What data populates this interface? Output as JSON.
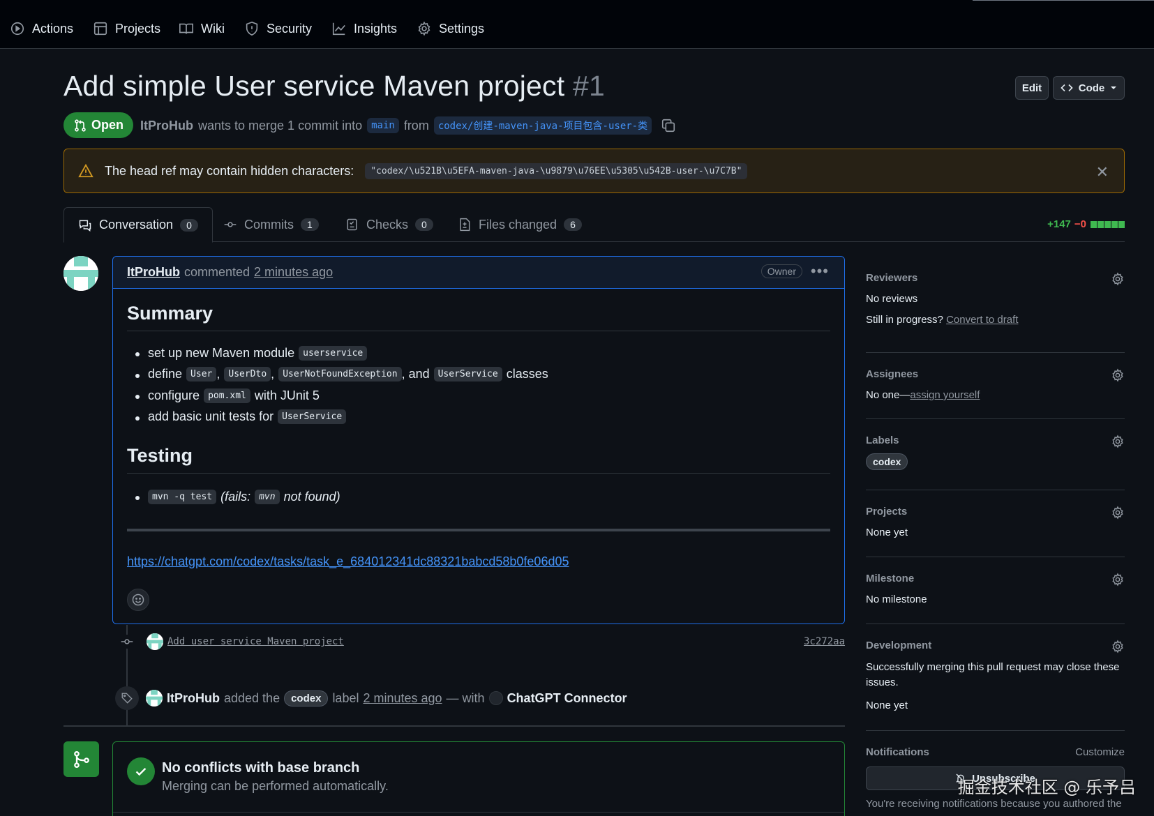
{
  "nav": {
    "items": [
      {
        "label": "Actions",
        "icon": "play-circle-icon"
      },
      {
        "label": "Projects",
        "icon": "table-icon"
      },
      {
        "label": "Wiki",
        "icon": "book-icon"
      },
      {
        "label": "Security",
        "icon": "shield-icon"
      },
      {
        "label": "Insights",
        "icon": "graph-icon"
      },
      {
        "label": "Settings",
        "icon": "gear-icon"
      }
    ]
  },
  "pr": {
    "title": "Add simple User service Maven project",
    "number": "#1",
    "edit_label": "Edit",
    "code_label": "Code",
    "state": "Open",
    "author": "ItProHub",
    "merge_text": "wants to merge 1 commit into",
    "base_branch": "main",
    "from_text": "from",
    "head_branch": "codex/创建-maven-java-项目包含-user-类"
  },
  "warning": {
    "text": "The head ref may contain hidden characters:",
    "ref": "\"codex/\\u521B\\u5EFA-maven-java-\\u9879\\u76EE\\u5305\\u542B-user-\\u7C7B\""
  },
  "tabs": [
    {
      "label": "Conversation",
      "count": "0"
    },
    {
      "label": "Commits",
      "count": "1"
    },
    {
      "label": "Checks",
      "count": "0"
    },
    {
      "label": "Files changed",
      "count": "6"
    }
  ],
  "diffstat": {
    "additions": "+147",
    "deletions": "−0"
  },
  "comment": {
    "author": "ItProHub",
    "action": "commented",
    "time": "2 minutes ago",
    "role": "Owner",
    "summary_heading": "Summary",
    "summary": {
      "item1_text": "set up new Maven module",
      "item1_code": "userservice",
      "item2_text": "define",
      "item2_code1": "User",
      "item2_code2": "UserDto",
      "item2_code3": "UserNotFoundException",
      "item2_and": ", and",
      "item2_code4": "UserService",
      "item2_tail": "classes",
      "item3_text": "configure",
      "item3_code": "pom.xml",
      "item3_tail": "with JUnit 5",
      "item4_text": "add basic unit tests for",
      "item4_code": "UserService"
    },
    "testing_heading": "Testing",
    "testing": {
      "code1": "mvn -q test",
      "fails": "(fails:",
      "code2": "mvn",
      "tail": "not found)"
    },
    "link": "https://chatgpt.com/codex/tasks/task_e_684012341dc88321babcd58b0fe06d05"
  },
  "timeline": {
    "commit_message": "Add user service Maven project",
    "commit_sha": "3c272aa",
    "label_author": "ItProHub",
    "label_added": "added the",
    "label_name": "codex",
    "label_word": "label",
    "label_time": "2 minutes ago",
    "label_with": "— with",
    "connector": "ChatGPT Connector"
  },
  "merge": {
    "title": "No conflicts with base branch",
    "subtitle": "Merging can be performed automatically."
  },
  "sidebar": {
    "reviewers": {
      "title": "Reviewers",
      "value": "No reviews",
      "progress_text": "Still in progress?",
      "progress_link": "Convert to draft"
    },
    "assignees": {
      "title": "Assignees",
      "value": "No one—",
      "link": "assign yourself"
    },
    "labels": {
      "title": "Labels",
      "value": "codex"
    },
    "projects": {
      "title": "Projects",
      "value": "None yet"
    },
    "milestone": {
      "title": "Milestone",
      "value": "No milestone"
    },
    "development": {
      "title": "Development",
      "text": "Successfully merging this pull request may close these issues.",
      "value": "None yet"
    },
    "notifications": {
      "title": "Notifications",
      "customize": "Customize",
      "button": "Unsubscribe",
      "text": "You're receiving notifications because you authored the"
    }
  },
  "watermark": "掘金技术社区 @ 乐予吕",
  "colors": {
    "background": "#0d1117",
    "accent_green": "#238636",
    "link_blue": "#4493f8",
    "warning_border": "#9e6a03"
  }
}
